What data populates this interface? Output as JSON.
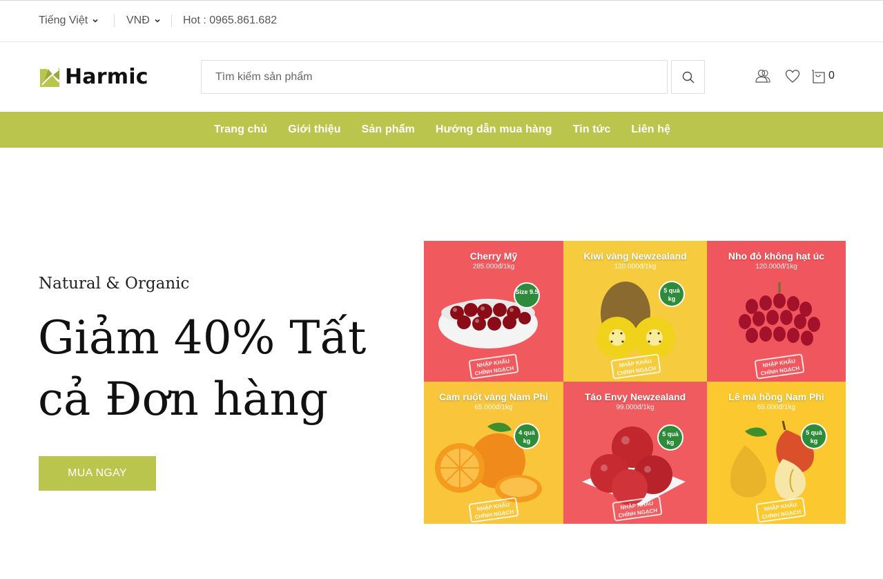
{
  "topbar": {
    "language": "Tiếng Việt",
    "currency": "VNĐ",
    "hotline": "Hot : 0965.861.682"
  },
  "header": {
    "logo_text": "Harmic",
    "search_placeholder": "Tìm kiếm sản phẩm",
    "cart_count": "0",
    "icons": [
      "user-icon",
      "heart-icon",
      "cart-icon",
      "search-icon"
    ]
  },
  "nav": {
    "items": [
      "Trang chủ",
      "Giới thiệu",
      "Sản phẩm",
      "Hướng dẫn mua hàng",
      "Tin tức",
      "Liên hệ"
    ]
  },
  "hero": {
    "subtitle": "Natural & Organic",
    "title": "Giảm 40% Tất cả Đơn hàng",
    "cta": "MUA NGAY"
  },
  "banner": {
    "tiles": [
      {
        "name": "Cherry Mỹ",
        "price": "285.000đ/1kg",
        "badge": "Size 9.5"
      },
      {
        "name": "Kiwi vàng Newzealand",
        "price": "120.000đ/1kg",
        "badge": "5 quả kg"
      },
      {
        "name": "Nho đỏ không hạt úc",
        "price": "120.000đ/1kg",
        "badge": ""
      },
      {
        "name": "Cam ruột vàng Nam Phi",
        "price": "65.000đ/1kg",
        "badge": "4 quả kg"
      },
      {
        "name": "Táo Envy Newzealand",
        "price": "99.000đ/1kg",
        "badge": "5 quả kg"
      },
      {
        "name": "Lê má hồng Nam Phi",
        "price": "65.000đ/1kg",
        "badge": "5 quả kg"
      }
    ],
    "stamp": "NHẬP KHẨU CHÍNH NGẠCH"
  },
  "colors": {
    "accent": "#b9c54d",
    "tile_red": "#f0575e",
    "tile_yellow": "#f7c93a"
  }
}
